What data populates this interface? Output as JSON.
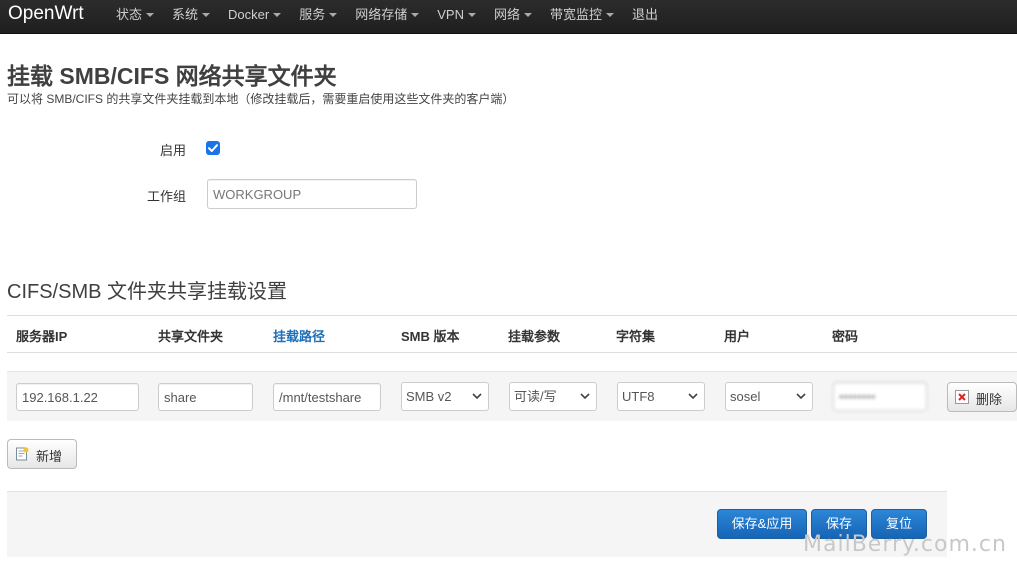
{
  "nav": {
    "brand": "OpenWrt",
    "items": [
      {
        "label": "状态",
        "caret": true
      },
      {
        "label": "系统",
        "caret": true
      },
      {
        "label": "Docker",
        "caret": true
      },
      {
        "label": "服务",
        "caret": true
      },
      {
        "label": "网络存储",
        "caret": true
      },
      {
        "label": "VPN",
        "caret": true
      },
      {
        "label": "网络",
        "caret": true
      },
      {
        "label": "带宽监控",
        "caret": true
      },
      {
        "label": "退出",
        "caret": false
      }
    ]
  },
  "page": {
    "title": "挂载 SMB/CIFS 网络共享文件夹",
    "description": "可以将 SMB/CIFS 的共享文件夹挂载到本地（修改挂载后，需要重启使用这些文件夹的客户端）"
  },
  "form": {
    "enable_label": "启用",
    "enabled": true,
    "workgroup_label": "工作组",
    "workgroup_placeholder": "WORKGROUP"
  },
  "section": {
    "title": "CIFS/SMB 文件夹共享挂载设置",
    "columns": [
      "服务器IP",
      "共享文件夹",
      "挂载路径",
      "SMB 版本",
      "挂载参数",
      "字符集",
      "用户",
      "密码"
    ],
    "row": {
      "server_ip": "192.168.1.22",
      "share": "share",
      "mount_path": "/mnt/testshare",
      "smb_version": "SMB v2",
      "mount_options": "可读/写",
      "charset": "UTF8",
      "user": "sosel",
      "password": "••••••••"
    },
    "delete_label": "删除",
    "add_label": "新增"
  },
  "actions": {
    "save_apply": "保存&应用",
    "save": "保存",
    "reset": "复位"
  },
  "watermark": "MailBerry.com.cn",
  "colors": {
    "accent": "#1a73e8",
    "primary_button": "#1f6fc0",
    "link": "#1d6fb8"
  }
}
